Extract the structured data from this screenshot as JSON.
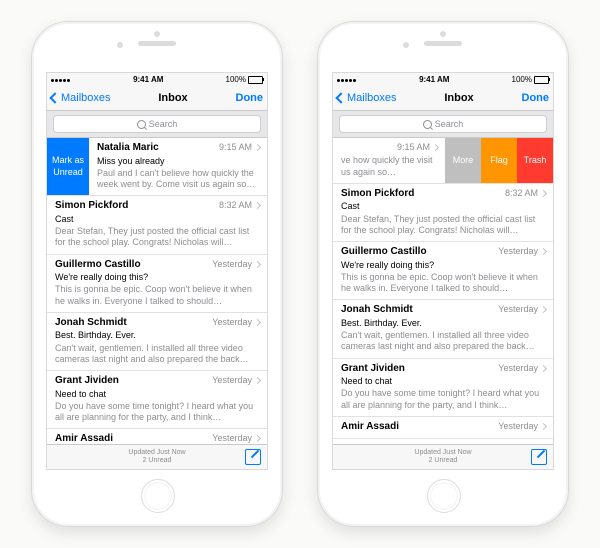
{
  "status": {
    "time": "9:41 AM",
    "battery": "100%"
  },
  "nav": {
    "back": "Mailboxes",
    "title": "Inbox",
    "done": "Done"
  },
  "search": {
    "placeholder": "Search"
  },
  "swipe": {
    "mark_unread": "Mark as Unread",
    "more": "More",
    "flag": "Flag",
    "trash": "Trash"
  },
  "toolbar": {
    "updated": "Updated Just Now",
    "unread": "2 Unread"
  },
  "left_cells": [
    {
      "sender": "Natalia Maric",
      "time": "9:15 AM",
      "subject": "Miss you already",
      "preview": "Paul and I can't believe how quickly the week went by. Come visit us again so…",
      "swiped": "left"
    },
    {
      "sender": "Simon Pickford",
      "time": "8:32 AM",
      "subject": "Cast",
      "preview": "Dear Stefan, They just posted the official cast list for the school play. Congrats! Nicholas will…"
    },
    {
      "sender": "Guillermo Castillo",
      "time": "Yesterday",
      "subject": "We're really doing this?",
      "preview": "This is gonna be epic. Coop won't believe it when he walks in. Everyone I talked to should…"
    },
    {
      "sender": "Jonah Schmidt",
      "time": "Yesterday",
      "subject": "Best. Birthday. Ever.",
      "preview": "Can't wait, gentlemen. I installed all three video cameras last night and also prepared the back…"
    },
    {
      "sender": "Grant Jividen",
      "time": "Yesterday",
      "subject": "Need to chat",
      "preview": "Do you have some time tonight? I heard what you all are planning for the party, and I think…"
    },
    {
      "sender": "Amir Assadi",
      "time": "Yesterday",
      "subject": "",
      "preview": ""
    }
  ],
  "right_cells": [
    {
      "sender": "",
      "time": "9:15 AM",
      "subject": "",
      "preview": "ve how quickly the visit us again so…",
      "swiped": "right"
    },
    {
      "sender": "Simon Pickford",
      "time": "8:32 AM",
      "subject": "Cast",
      "preview": "Dear Stefan, They just posted the official cast list for the school play. Congrats! Nicholas will…"
    },
    {
      "sender": "Guillermo Castillo",
      "time": "Yesterday",
      "subject": "We're really doing this?",
      "preview": "This is gonna be epic. Coop won't believe it when he walks in. Everyone I talked to should…"
    },
    {
      "sender": "Jonah Schmidt",
      "time": "Yesterday",
      "subject": "Best. Birthday. Ever.",
      "preview": "Can't wait, gentlemen. I installed all three video cameras last night and also prepared the back…"
    },
    {
      "sender": "Grant Jividen",
      "time": "Yesterday",
      "subject": "Need to chat",
      "preview": "Do you have some time tonight? I heard what you all are planning for the party, and I think…"
    },
    {
      "sender": "Amir Assadi",
      "time": "Yesterday",
      "subject": "",
      "preview": ""
    }
  ]
}
